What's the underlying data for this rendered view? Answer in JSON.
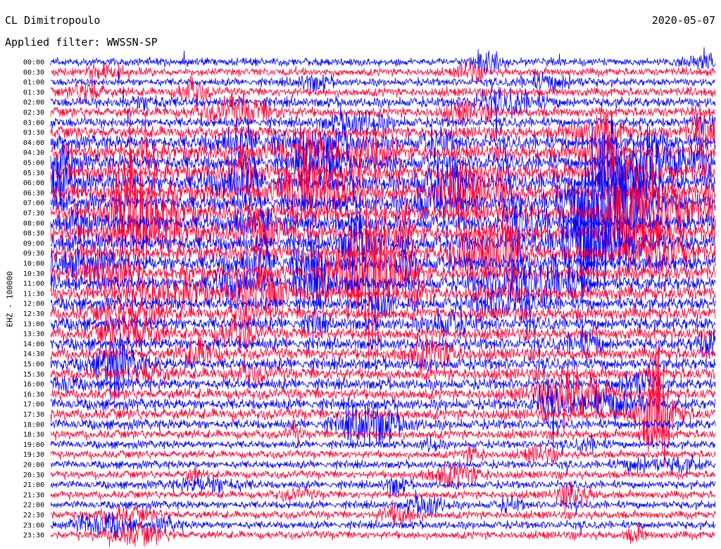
{
  "header": {
    "station": "CL Dimitropoulo",
    "date": "2020-05-07",
    "filter_label": "Applied filter: WWSSN-SP"
  },
  "axis": {
    "ylabel": "EHZ - 100000"
  },
  "chart_data": {
    "type": "line",
    "title": "CL Dimitropoulo",
    "subtitle": "Applied filter: WWSSN-SP",
    "ylabel": "EHZ - 100000",
    "trace_colors": [
      "#0000ff",
      "#ff0033"
    ],
    "rows": [
      "00:00",
      "00:30",
      "01:00",
      "01:30",
      "02:00",
      "02:30",
      "03:00",
      "03:30",
      "04:00",
      "04:30",
      "05:00",
      "05:30",
      "06:00",
      "06:30",
      "07:00",
      "07:30",
      "08:00",
      "08:30",
      "09:00",
      "09:30",
      "10:00",
      "10:30",
      "11:00",
      "11:30",
      "12:00",
      "12:30",
      "13:00",
      "13:30",
      "14:00",
      "14:30",
      "15:00",
      "15:30",
      "16:00",
      "16:30",
      "17:00",
      "17:30",
      "18:00",
      "18:30",
      "19:00",
      "19:30",
      "20:00",
      "20:30",
      "21:00",
      "21:30",
      "22:00",
      "22:30",
      "23:00",
      "23:30"
    ],
    "noise_level": [
      0.3,
      0.3,
      0.3,
      0.4,
      0.5,
      0.5,
      0.5,
      0.7,
      0.9,
      1.0,
      1.1,
      1.2,
      1.2,
      1.2,
      1.2,
      1.2,
      1.2,
      1.2,
      1.2,
      1.1,
      1.1,
      1.0,
      0.9,
      0.9,
      0.8,
      0.8,
      0.8,
      0.7,
      0.7,
      0.7,
      0.7,
      0.7,
      0.6,
      0.6,
      0.6,
      0.6,
      0.5,
      0.4,
      0.3,
      0.3,
      0.3,
      0.3,
      0.3,
      0.3,
      0.3,
      0.3,
      0.3,
      0.3
    ],
    "grid": false
  }
}
